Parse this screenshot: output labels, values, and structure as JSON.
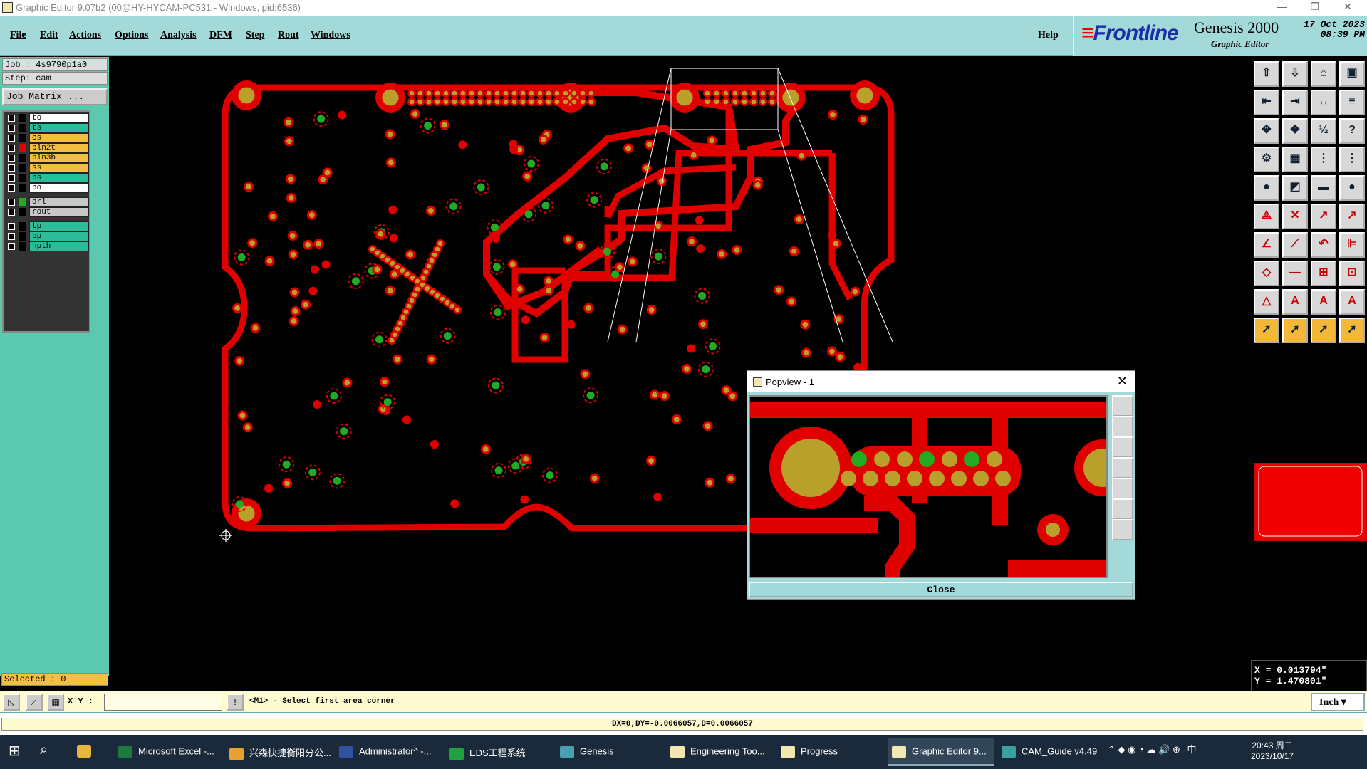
{
  "window": {
    "title": "Graphic Editor 9.07b2 (00@HY-HYCAM-PC531 - Windows, pid:6536)"
  },
  "menu": {
    "items": [
      "File",
      "Edit",
      "Actions",
      "Options",
      "Analysis",
      "DFM",
      "Step",
      "Rout",
      "Windows"
    ],
    "help": "Help"
  },
  "brand": {
    "logo": "Frontline",
    "product": "Genesis 2000",
    "subtitle": "Graphic Editor",
    "date": "17 Oct 2023",
    "time": "08:39 PM"
  },
  "job": {
    "job_line": "Job : 4s9790p1a0",
    "step_line": "Step: cam",
    "matrix_button": "Job Matrix ...",
    "selected": "Selected : 0"
  },
  "layers": [
    {
      "name": "to",
      "color": "#ffffff",
      "swatch": "#000000"
    },
    {
      "name": "ts",
      "color": "#2dbb9a",
      "swatch": "#000000"
    },
    {
      "name": "cs",
      "color": "#f2c040",
      "swatch": "#000000"
    },
    {
      "name": "pln2t",
      "color": "#f2c040",
      "swatch": "#e00000"
    },
    {
      "name": "pln3b",
      "color": "#f2c040",
      "swatch": "#000000"
    },
    {
      "name": "ss",
      "color": "#f2c040",
      "swatch": "#000000"
    },
    {
      "name": "bs",
      "color": "#2dbb9a",
      "swatch": "#000000"
    },
    {
      "name": "bo",
      "color": "#ffffff",
      "swatch": "#000000"
    },
    {
      "name": "drl",
      "color": "#c8c8c8",
      "swatch": "#22aa22"
    },
    {
      "name": "rout",
      "color": "#c8c8c8",
      "swatch": "#000000"
    },
    {
      "name": "tp",
      "color": "#2dbb9a",
      "swatch": "#000000"
    },
    {
      "name": "bp",
      "color": "#2dbb9a",
      "swatch": "#000000"
    },
    {
      "name": "npth",
      "color": "#2dbb9a",
      "swatch": "#000000"
    }
  ],
  "coords": {
    "x": "X = 0.013794\"",
    "y": "Y = 1.470801\""
  },
  "command": {
    "xy_label": "X Y :",
    "xy_value": "",
    "prompt": "<M1> - Select first area corner",
    "unit": "Inch"
  },
  "status": {
    "measure": "DX=0,DY=-0.0066057,D=0.0066057"
  },
  "popup": {
    "title": "Popview - 1",
    "close_label": "Close"
  },
  "taskbar": {
    "items": [
      {
        "label": "Microsoft Excel -...",
        "color": "#1e7a3c"
      },
      {
        "label": "兴森快捷衡阳分公...",
        "color": "#e8a030"
      },
      {
        "label": "Administrator^ -...",
        "color": "#3050a0"
      },
      {
        "label": "EDS工程系统",
        "color": "#20a040"
      },
      {
        "label": "Genesis",
        "color": "#4aa0b0"
      },
      {
        "label": "Engineering Too...",
        "color": "#f4e6b0"
      },
      {
        "label": "Progress",
        "color": "#f4e6b0"
      },
      {
        "label": "Graphic Editor 9...",
        "color": "#f4e6b0"
      },
      {
        "label": "CAM_Guide v4.49",
        "color": "#3aa0a0"
      }
    ],
    "clock_time": "20:43 周二",
    "clock_date": "2023/10/17",
    "ime": "中"
  }
}
